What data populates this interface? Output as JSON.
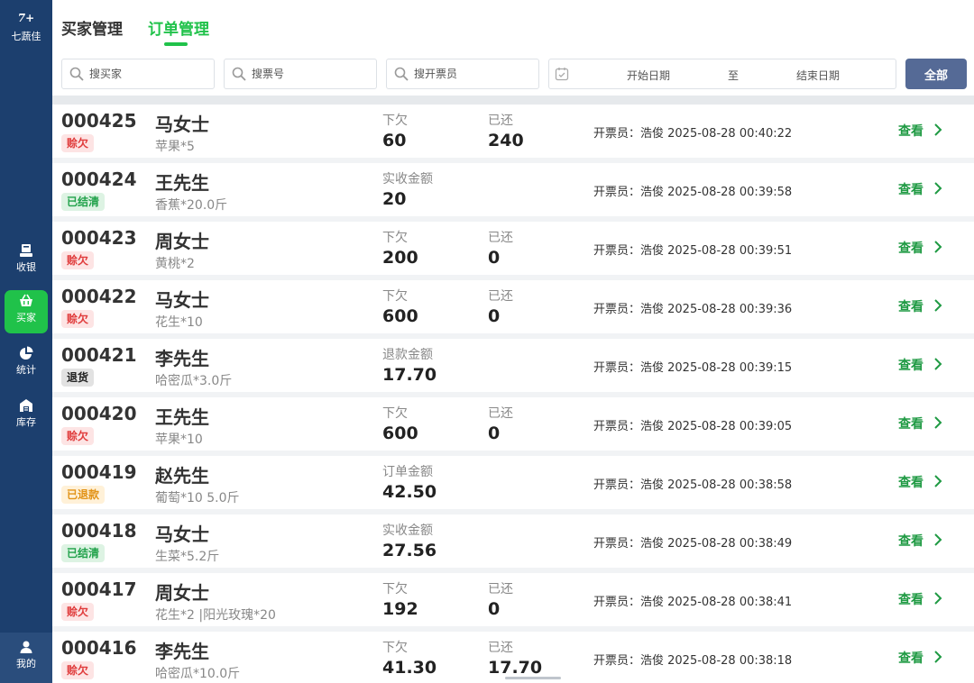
{
  "app": {
    "logo_mark": "7",
    "logo_sup": "+",
    "name": "七蔬佳"
  },
  "sidebar": {
    "items": [
      {
        "label": "收银",
        "icon": "cashier-icon"
      },
      {
        "label": "买家",
        "icon": "basket-icon",
        "active": true
      },
      {
        "label": "统计",
        "icon": "pie-chart-icon"
      },
      {
        "label": "库存",
        "icon": "warehouse-icon"
      }
    ],
    "bottom": {
      "label": "我的",
      "icon": "user-icon"
    }
  },
  "tabs": [
    {
      "label": "买家管理",
      "active": false
    },
    {
      "label": "订单管理",
      "active": true
    }
  ],
  "filters": {
    "buyer_placeholder": "搜买家",
    "ticket_placeholder": "搜票号",
    "issuer_placeholder": "搜开票员",
    "start_date": "开始日期",
    "to": "至",
    "end_date": "结束日期",
    "all_button": "全部"
  },
  "accent_green": "#20c24a",
  "sidebar_color": "#1c3f6e",
  "orders": [
    {
      "id": "000425",
      "status": "赊欠",
      "status_color": "red",
      "buyer": "马女士",
      "items": "苹果*5",
      "label1": "下欠",
      "value1": "60",
      "label2": "已还",
      "value2": "240",
      "issuer": "开票员：浩俊 2025-08-28 00:40:22",
      "action": "查看"
    },
    {
      "id": "000424",
      "status": "已结清",
      "status_color": "green",
      "buyer": "王先生",
      "items": "香蕉*20.0斤",
      "label1": "实收金额",
      "value1": "20",
      "label2": "",
      "value2": "",
      "issuer": "开票员：浩俊 2025-08-28 00:39:58",
      "action": "查看"
    },
    {
      "id": "000423",
      "status": "赊欠",
      "status_color": "red",
      "buyer": "周女士",
      "items": "黄桃*2",
      "label1": "下欠",
      "value1": "200",
      "label2": "已还",
      "value2": "0",
      "issuer": "开票员：浩俊 2025-08-28 00:39:51",
      "action": "查看"
    },
    {
      "id": "000422",
      "status": "赊欠",
      "status_color": "red",
      "buyer": "马女士",
      "items": "花生*10",
      "label1": "下欠",
      "value1": "600",
      "label2": "已还",
      "value2": "0",
      "issuer": "开票员：浩俊 2025-08-28 00:39:36",
      "action": "查看"
    },
    {
      "id": "000421",
      "status": "退货",
      "status_color": "gray",
      "buyer": "李先生",
      "items": "哈密瓜*3.0斤",
      "label1": "退款金额",
      "value1": "17.70",
      "label2": "",
      "value2": "",
      "issuer": "开票员：浩俊 2025-08-28 00:39:15",
      "action": "查看"
    },
    {
      "id": "000420",
      "status": "赊欠",
      "status_color": "red",
      "buyer": "王先生",
      "items": "苹果*10",
      "label1": "下欠",
      "value1": "600",
      "label2": "已还",
      "value2": "0",
      "issuer": "开票员：浩俊 2025-08-28 00:39:05",
      "action": "查看"
    },
    {
      "id": "000419",
      "status": "已退款",
      "status_color": "orange",
      "buyer": "赵先生",
      "items": "葡萄*10 5.0斤",
      "label1": "订单金额",
      "value1": "42.50",
      "label2": "",
      "value2": "",
      "issuer": "开票员：浩俊 2025-08-28 00:38:58",
      "action": "查看"
    },
    {
      "id": "000418",
      "status": "已结清",
      "status_color": "green",
      "buyer": "马女士",
      "items": "生菜*5.2斤",
      "label1": "实收金额",
      "value1": "27.56",
      "label2": "",
      "value2": "",
      "issuer": "开票员：浩俊 2025-08-28 00:38:49",
      "action": "查看"
    },
    {
      "id": "000417",
      "status": "赊欠",
      "status_color": "red",
      "buyer": "周女士",
      "items": "花生*2 |阳光玫瑰*20",
      "label1": "下欠",
      "value1": "192",
      "label2": "已还",
      "value2": "0",
      "issuer": "开票员：浩俊 2025-08-28 00:38:41",
      "action": "查看"
    },
    {
      "id": "000416",
      "status": "赊欠",
      "status_color": "red",
      "buyer": "李先生",
      "items": "哈密瓜*10.0斤",
      "label1": "下欠",
      "value1": "41.30",
      "label2": "已还",
      "value2": "17.70",
      "issuer": "开票员：浩俊 2025-08-28 00:38:18",
      "action": "查看"
    }
  ]
}
